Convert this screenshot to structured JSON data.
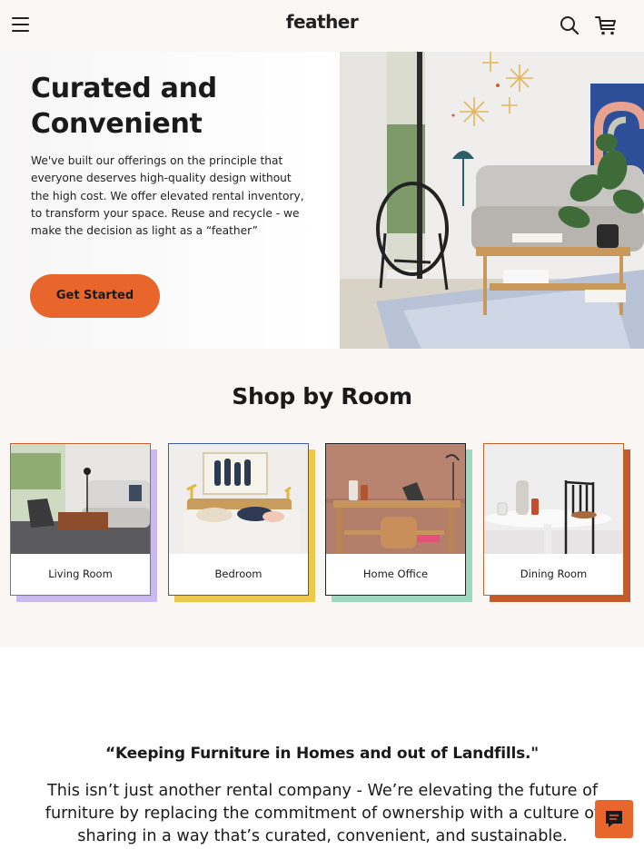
{
  "header": {
    "logo": "feather",
    "menu_icon": "hamburger-menu-icon",
    "search_icon": "search-icon",
    "cart_icon": "cart-icon"
  },
  "hero": {
    "title": "Curated and Convenient",
    "description": "We've built our offerings on the principle that everyone deserves high-quality design without the high cost. We offer elevated rental inventory, to transform your space. Reuse and recycle - we make the decision as light as a “feather”",
    "cta_label": "Get Started",
    "cta_color": "#e8652c"
  },
  "shop": {
    "title": "Shop by Room",
    "rooms": [
      {
        "label": "Living Room",
        "accent": "#c9b9ee",
        "border": "#c0632f"
      },
      {
        "label": "Bedroom",
        "accent": "#ecc94b",
        "border": "#3d5ca3"
      },
      {
        "label": "Home Office",
        "accent": "#9fd8bf",
        "border": "#222222"
      },
      {
        "label": "Dining Room",
        "accent": "#c45a2b",
        "border": "#c0632f"
      }
    ]
  },
  "mission": {
    "quote": "“Keeping Furniture in Homes and out of Landfills.\"",
    "text": "This isn’t just another rental company - We’re elevating the future of furniture by replacing the commitment of ownership with a culture of sharing in a way that’s curated, convenient, and sustainable."
  },
  "chat": {
    "icon": "chat-icon"
  }
}
